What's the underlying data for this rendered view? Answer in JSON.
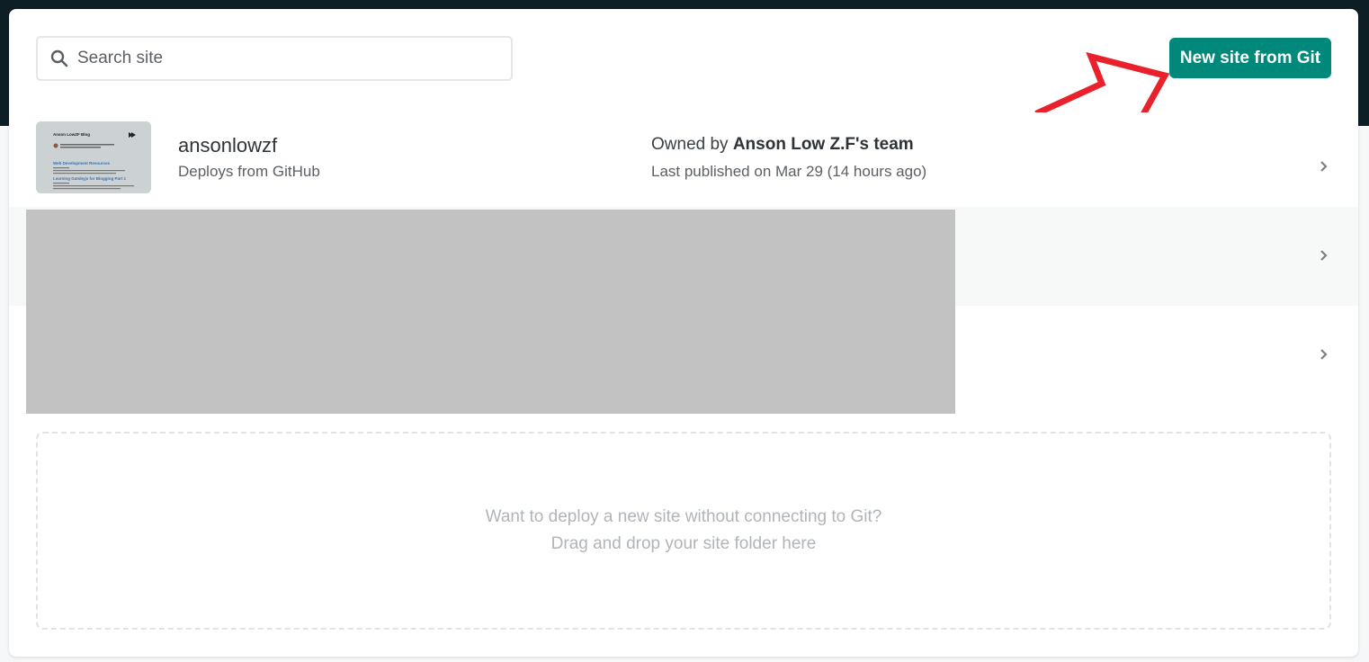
{
  "search": {
    "placeholder": "Search site"
  },
  "toolbar": {
    "new_site_label": "New site from Git"
  },
  "sites": [
    {
      "name": "ansonlowzf",
      "source": "Deploys from GitHub",
      "owner_prefix": "Owned by ",
      "owner": "Anson Low Z.F's team",
      "published": "Last published on Mar 29 (14 hours ago)",
      "thumbnail": {
        "title": "Anson LowZF Blog",
        "heading1": "Web Development Resources",
        "heading2": "Learning Gatsbyjs for Blogging Part 1"
      }
    }
  ],
  "dropzone": {
    "line1": "Want to deploy a new site without connecting to Git?",
    "line2": "Drag and drop your site folder here"
  },
  "colors": {
    "accent": "#00897b",
    "annotation_arrow": "#e8212b",
    "topbar": "#0e1e25"
  },
  "icons": {
    "search": "search-icon",
    "chevron": "chevron-right-icon",
    "arrow": "annotation-arrow-icon"
  }
}
